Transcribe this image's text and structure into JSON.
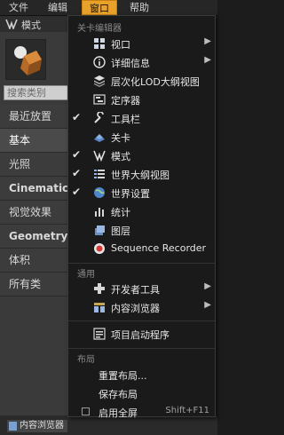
{
  "menubar": {
    "file": "文件",
    "edit": "编辑",
    "window": "窗口",
    "help": "帮助"
  },
  "left_panel": {
    "modes_title": "模式",
    "search_placeholder": "搜索类别",
    "categories": [
      "最近放置",
      "基本",
      "光照",
      "Cinematic",
      "视觉效果",
      "Geometry",
      "体积",
      "所有类"
    ],
    "selected_category": "基本"
  },
  "dropdown": {
    "section_level_editor": "关卡编辑器",
    "items_level": [
      {
        "label": "视口",
        "icon": "viewport-icon",
        "submenu": true,
        "checked": false
      },
      {
        "label": "详细信息",
        "icon": "info-icon",
        "submenu": true,
        "checked": false
      },
      {
        "label": "层次化LOD大纲视图",
        "icon": "hlod-icon",
        "submenu": false,
        "checked": false
      },
      {
        "label": "定序器",
        "icon": "sequencer-icon",
        "submenu": false,
        "checked": false
      },
      {
        "label": "工具栏",
        "icon": "toolbar-icon",
        "submenu": false,
        "checked": true
      },
      {
        "label": "关卡",
        "icon": "levels-icon",
        "submenu": false,
        "checked": false
      },
      {
        "label": "模式",
        "icon": "modes-icon",
        "submenu": false,
        "checked": true
      },
      {
        "label": "世界大纲视图",
        "icon": "outliner-icon",
        "submenu": false,
        "checked": true
      },
      {
        "label": "世界设置",
        "icon": "world-settings-icon",
        "submenu": false,
        "checked": true
      },
      {
        "label": "统计",
        "icon": "stats-icon",
        "submenu": false,
        "checked": false
      },
      {
        "label": "图层",
        "icon": "layers-icon",
        "submenu": false,
        "checked": false
      },
      {
        "label": "Sequence Recorder",
        "icon": "record-icon",
        "submenu": false,
        "checked": false
      }
    ],
    "section_general": "通用",
    "items_general": [
      {
        "label": "开发者工具",
        "icon": "developer-tools-icon",
        "submenu": true
      },
      {
        "label": "内容浏览器",
        "icon": "content-browser-icon",
        "submenu": true
      },
      {
        "label": "项目启动程序",
        "icon": "project-launcher-icon",
        "submenu": false
      }
    ],
    "section_layout": "布局",
    "items_layout": [
      {
        "label": "重置布局..."
      },
      {
        "label": "保存布局"
      }
    ],
    "fullscreen_label": "启用全屏",
    "fullscreen_shortcut": "Shift+F11"
  },
  "statusbar": {
    "content_browser_tab": "内容浏览器"
  }
}
